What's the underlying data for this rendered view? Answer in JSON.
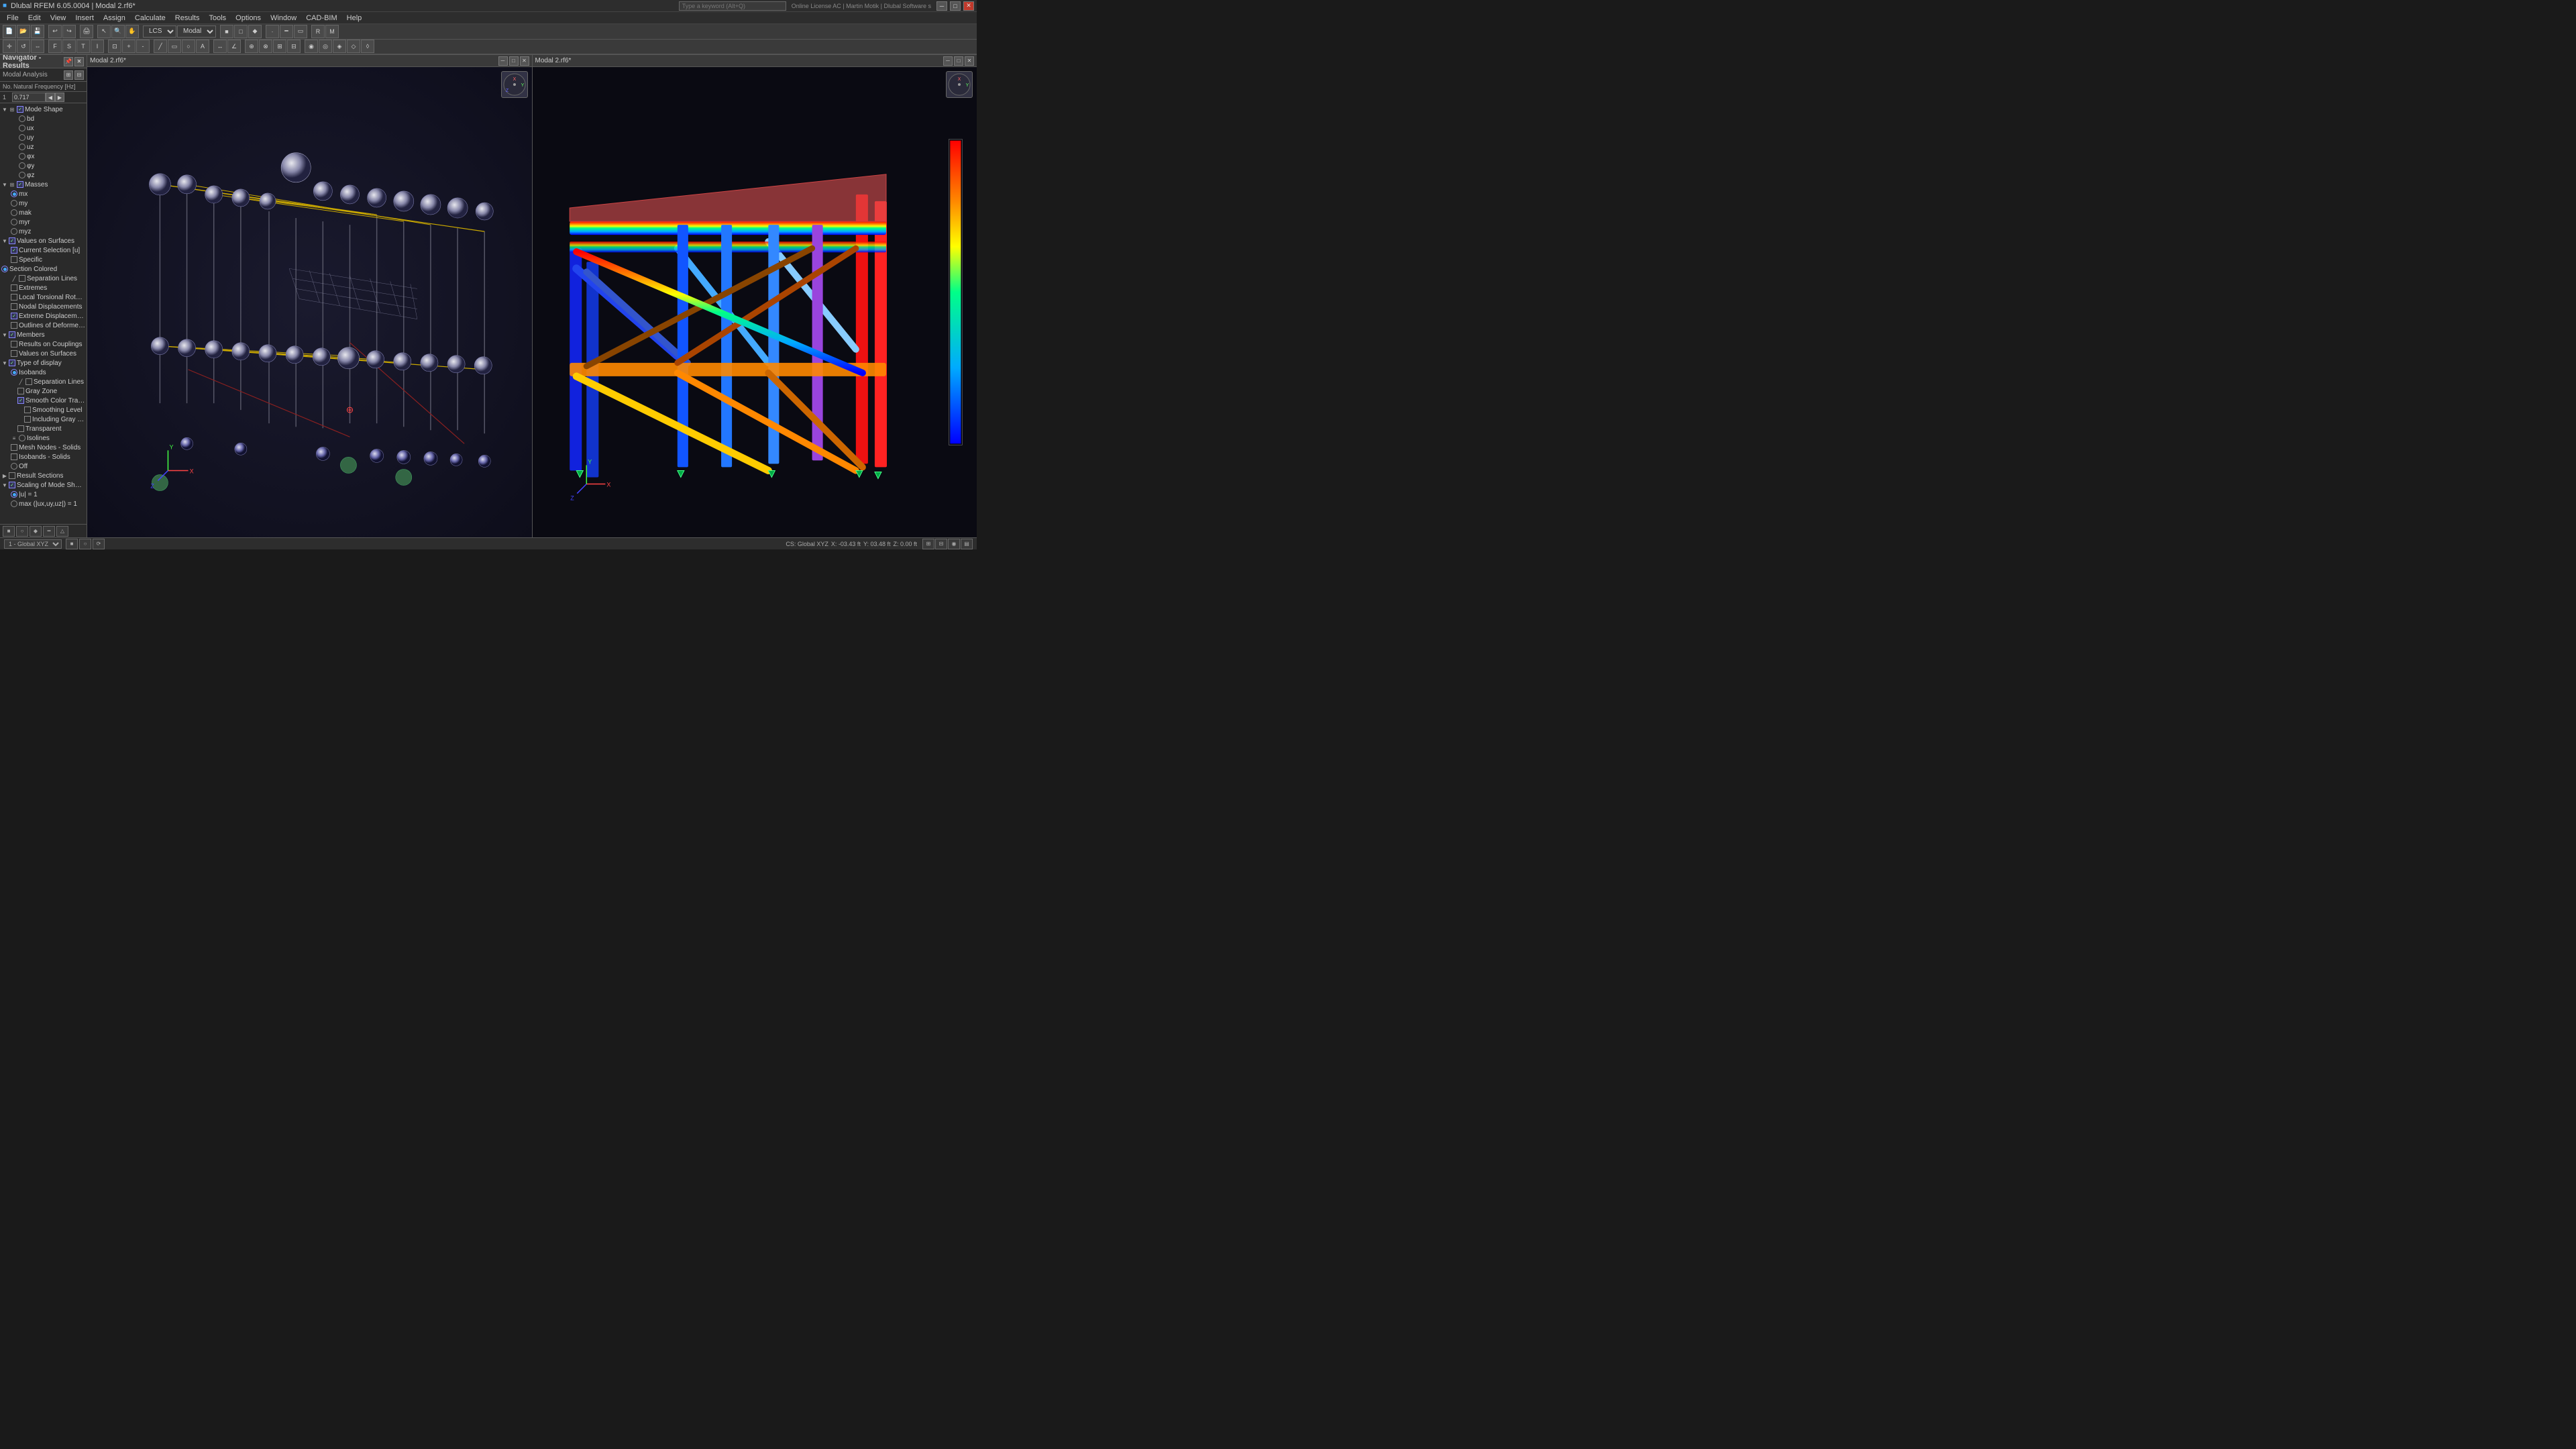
{
  "app": {
    "title": "Dlubal RFEM 6.05.0004 | Modal 2.rf6*",
    "version": "6.05.0004"
  },
  "title_bar": {
    "minimize": "─",
    "maximize": "□",
    "close": "✕"
  },
  "menu": {
    "items": [
      "File",
      "Edit",
      "View",
      "Insert",
      "Assign",
      "Calculate",
      "Results",
      "Tools",
      "Options",
      "Window",
      "CAD-BIM",
      "Help"
    ]
  },
  "toolbar": {
    "lcs_label": "LCS",
    "modal_label": "Modal",
    "search_placeholder": "Type a keyword (Alt+Q)"
  },
  "navigator": {
    "title": "Navigator - Results",
    "sub_label": "Modal Analysis",
    "no_label": "No.",
    "freq_label": "Natural Frequency [Hz]",
    "freq_value": "0.717",
    "tree_items": [
      {
        "id": "mode_shape",
        "label": "Mode Shape",
        "type": "group",
        "level": 0,
        "expand": true
      },
      {
        "id": "bd",
        "label": "bd",
        "type": "radio",
        "level": 1,
        "checked": false
      },
      {
        "id": "ux",
        "label": "ux",
        "type": "radio",
        "level": 1,
        "checked": false
      },
      {
        "id": "uy",
        "label": "uy",
        "type": "radio",
        "level": 1,
        "checked": false
      },
      {
        "id": "uz",
        "label": "uz",
        "type": "radio",
        "level": 1,
        "checked": false
      },
      {
        "id": "px",
        "label": "φx",
        "type": "radio",
        "level": 1,
        "checked": false
      },
      {
        "id": "py",
        "label": "φy",
        "type": "radio",
        "level": 1,
        "checked": false
      },
      {
        "id": "pz",
        "label": "φz",
        "type": "radio",
        "level": 1,
        "checked": false
      },
      {
        "id": "masses",
        "label": "Masses",
        "type": "group",
        "level": 0,
        "expand": true
      },
      {
        "id": "mx",
        "label": "mx",
        "type": "radio",
        "level": 1,
        "checked": true
      },
      {
        "id": "my",
        "label": "my",
        "type": "radio",
        "level": 1,
        "checked": false
      },
      {
        "id": "mak",
        "label": "mak",
        "type": "radio",
        "level": 1,
        "checked": false
      },
      {
        "id": "myr",
        "label": "myr",
        "type": "radio",
        "level": 1,
        "checked": false
      },
      {
        "id": "myz",
        "label": "myz",
        "type": "radio",
        "level": 1,
        "checked": false
      },
      {
        "id": "values_surfaces",
        "label": "Values on Surfaces",
        "type": "group",
        "level": 0,
        "expand": true
      },
      {
        "id": "current_selection",
        "label": "Current Selection [u]",
        "type": "check",
        "level": 1,
        "checked": true
      },
      {
        "id": "specific",
        "label": "Specific",
        "type": "check",
        "level": 1,
        "checked": false
      },
      {
        "id": "section_colored",
        "label": "Section Colored",
        "type": "radio",
        "level": 0,
        "checked": true
      },
      {
        "id": "sep_lines1",
        "label": "Separation Lines",
        "type": "check",
        "level": 1,
        "checked": false
      },
      {
        "id": "extremes",
        "label": "Extremes",
        "type": "check",
        "level": 1,
        "checked": false
      },
      {
        "id": "local_torsional",
        "label": "Local Torsional Rotatio...",
        "type": "check",
        "level": 1,
        "checked": false
      },
      {
        "id": "nodal_displacements",
        "label": "Nodal Displacements",
        "type": "check",
        "level": 1,
        "checked": false
      },
      {
        "id": "extreme_displacement",
        "label": "Extreme Displacement",
        "type": "check",
        "level": 1,
        "checked": true
      },
      {
        "id": "outlines_deformed",
        "label": "Outlines of Deformed Surf...",
        "type": "check",
        "level": 1,
        "checked": false
      },
      {
        "id": "members_group",
        "label": "Members",
        "type": "group",
        "level": 0,
        "expand": true
      },
      {
        "id": "results_couplings",
        "label": "Results on Couplings",
        "type": "check",
        "level": 1,
        "checked": false
      },
      {
        "id": "values_surfaces2",
        "label": "Values on Surfaces",
        "type": "check",
        "level": 1,
        "checked": false
      },
      {
        "id": "type_display",
        "label": "Type of display",
        "type": "group",
        "level": 0,
        "expand": true
      },
      {
        "id": "isobands",
        "label": "Isobands",
        "type": "radio",
        "level": 1,
        "checked": true
      },
      {
        "id": "sep_lines2",
        "label": "Separation Lines",
        "type": "check",
        "level": 2,
        "checked": false
      },
      {
        "id": "gray_zone",
        "label": "Gray Zone",
        "type": "check",
        "level": 2,
        "checked": false
      },
      {
        "id": "smooth_color",
        "label": "Smooth Color Transi...",
        "type": "check",
        "level": 2,
        "checked": true
      },
      {
        "id": "smoothing_level",
        "label": "Smoothing Level",
        "type": "check",
        "level": 3,
        "checked": false
      },
      {
        "id": "including_gray",
        "label": "Including Gray Zo...",
        "type": "check",
        "level": 3,
        "checked": false
      },
      {
        "id": "transparent",
        "label": "Transparent",
        "type": "check",
        "level": 2,
        "checked": false
      },
      {
        "id": "isolines",
        "label": "Isolines",
        "type": "radio",
        "level": 1,
        "checked": false
      },
      {
        "id": "mesh_nodes_solids",
        "label": "Mesh Nodes - Solids",
        "type": "check",
        "level": 1,
        "checked": false
      },
      {
        "id": "isobands_solids",
        "label": "Isobands - Solids",
        "type": "check",
        "level": 1,
        "checked": false
      },
      {
        "id": "off",
        "label": "Off",
        "type": "radio",
        "level": 1,
        "checked": false
      },
      {
        "id": "result_sections",
        "label": "Result Sections",
        "type": "group",
        "level": 0,
        "expand": true
      },
      {
        "id": "scaling_mode",
        "label": "Scaling of Mode Shapes",
        "type": "group",
        "level": 0,
        "expand": true
      },
      {
        "id": "bd_eq1",
        "label": "|u| = 1",
        "type": "radio",
        "level": 1,
        "checked": true
      },
      {
        "id": "max_eq1",
        "label": "max (|ux,uy,uz|) = 1",
        "type": "radio",
        "level": 1,
        "checked": false
      }
    ]
  },
  "viewport_left": {
    "title": "Modal 2.rf6*",
    "window_btns": [
      "─",
      "□",
      "✕"
    ]
  },
  "viewport_right": {
    "title": "Modal 2.rf6*",
    "window_btns": [
      "─",
      "□",
      "✕"
    ]
  },
  "status_bar": {
    "cs_label": "CS: Global XYZ",
    "coord_x": "X: -03.43 ft",
    "coord_y": "Y: 03.48 ft",
    "coord_z": "Z: 0.00 ft",
    "bottom_left": "1 - Global XYZ"
  },
  "search": {
    "placeholder": "Type a keyword (Alt+Q)"
  },
  "license": {
    "label": "Online License AC | Martin Motik | Dlubal Software s"
  }
}
